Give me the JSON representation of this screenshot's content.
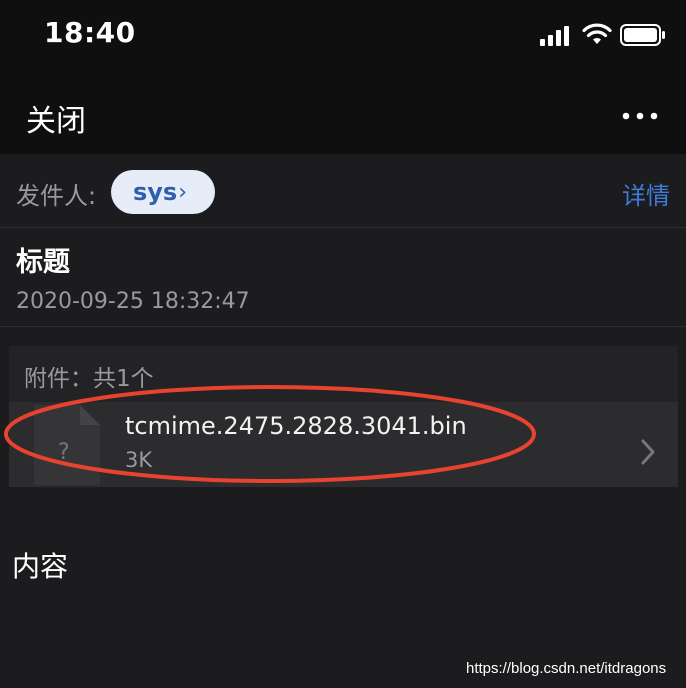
{
  "status_bar": {
    "time": "18:40"
  },
  "nav": {
    "close_label": "关闭",
    "more_icon": "more-dots-icon"
  },
  "sender": {
    "label": "发件人:",
    "name": "sys",
    "chevron": "›",
    "detail_link": "详情"
  },
  "message": {
    "subject": "标题",
    "datetime": "2020-09-25 18:32:47"
  },
  "attachments": {
    "header": "附件：共1个",
    "items": [
      {
        "file_icon_glyph": "?",
        "name": "tcmime.2475.2828.3041.bin",
        "size": "3K"
      }
    ]
  },
  "content": {
    "label": "内容"
  },
  "watermark": "https://blog.csdn.net/itdragons",
  "colors": {
    "background": "#1c1c1e",
    "link_blue": "#3f7bd8",
    "chip_bg": "#e6edf8",
    "annotation_red": "#e8432f"
  }
}
